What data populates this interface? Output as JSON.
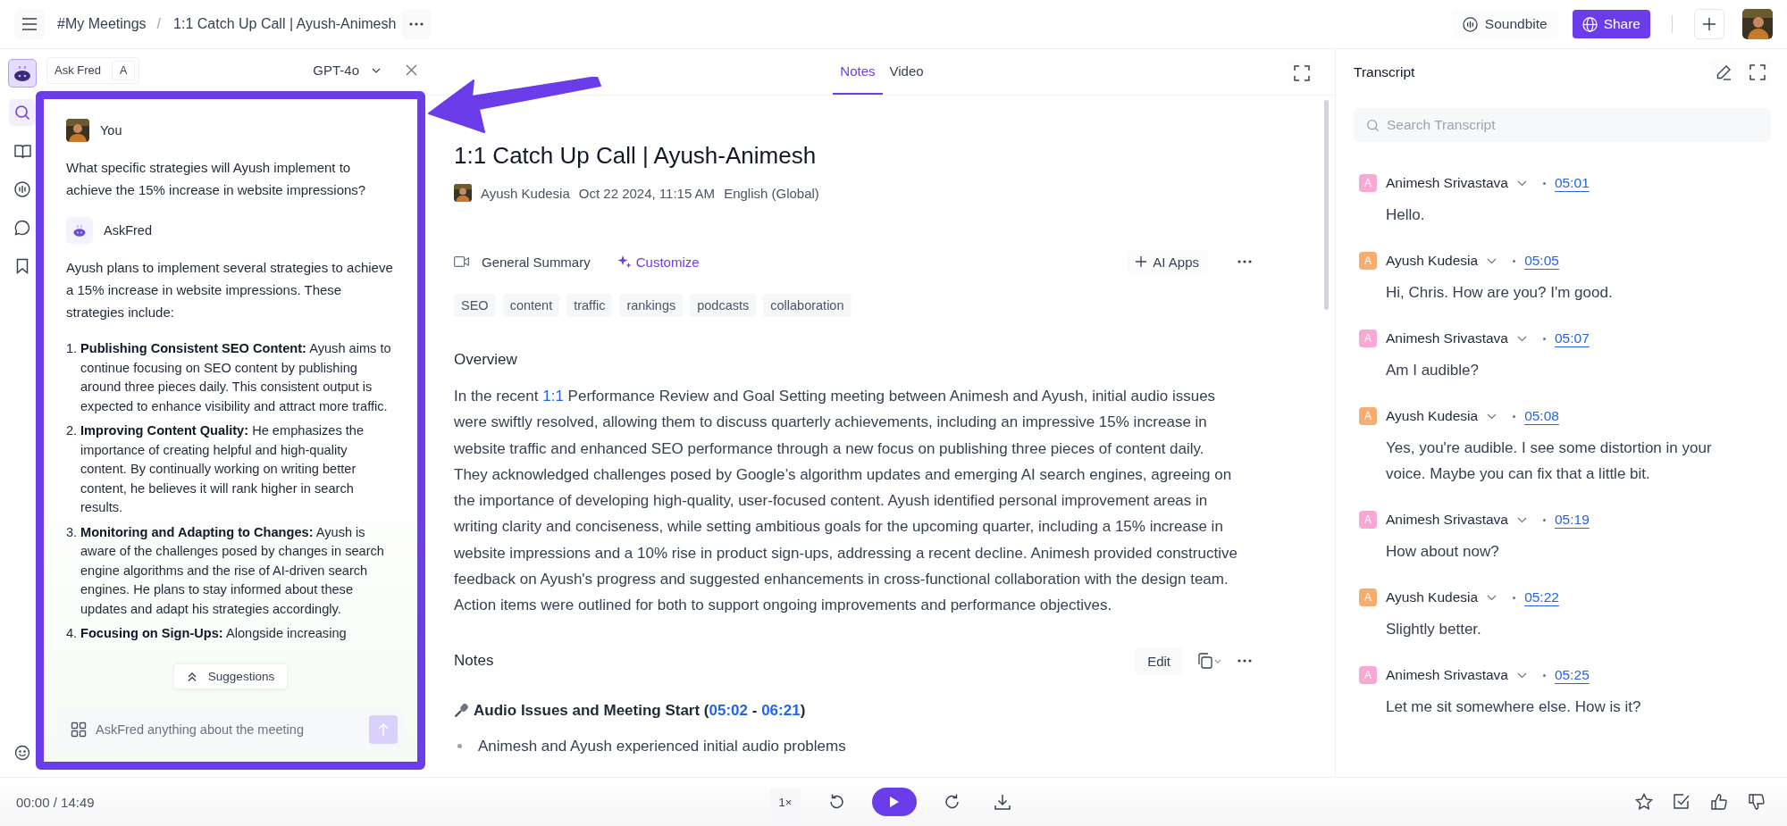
{
  "breadcrumb": {
    "items": [
      "#My Meetings",
      "1:1 Catch Up Call | Ayush-Animesh"
    ],
    "separator": "/"
  },
  "header_actions": {
    "soundbite": "Soundbite",
    "share": "Share"
  },
  "rail": [
    {
      "kind": "search",
      "selected": true
    },
    {
      "kind": "book",
      "selected": false
    },
    {
      "kind": "wave",
      "selected": false
    },
    {
      "kind": "chat",
      "selected": false
    },
    {
      "kind": "bookmark",
      "selected": false
    }
  ],
  "askfred": {
    "chip": "Ask Fred",
    "shortcut": "A",
    "model": "GPT-4o",
    "messages": [
      {
        "kind": "user",
        "author": "You",
        "text": "What specific strategies will Ayush implement to achieve the 15% increase in website impressions?"
      },
      {
        "kind": "bot",
        "author": "AskFred",
        "text": "Ayush plans to implement several strategies to achieve a 15% increase in website impressions. These strategies include:",
        "items": [
          {
            "num": "1.",
            "text": "**Publishing Consistent SEO Content:** Ayush aims to continue focusing on SEO content by publishing around three pieces daily. This consistent output is expected to enhance visibility and attract more traffic."
          },
          {
            "num": "2.",
            "text": "**Improving Content Quality:** He emphasizes the importance of creating helpful and high-quality content. By continually working on writing better content, he believes it will rank higher in search results."
          },
          {
            "num": "3.",
            "text": "**Monitoring and Adapting to Changes:** Ayush is aware of the challenges posed by changes in search engine algorithms and the rise of AI-driven search engines. He plans to stay informed about these updates and adapt his strategies accordingly."
          },
          {
            "num": "4.",
            "text": "**Focusing on Sign-Ups:** Alongside increasing"
          }
        ]
      }
    ],
    "suggestions": "Suggestions",
    "placeholder": "AskFred anything about the meeting"
  },
  "tabs": [
    {
      "label": "Notes",
      "selected": true
    },
    {
      "label": "Video",
      "selected": false
    }
  ],
  "meeting": {
    "title": "1:1 Catch Up Call | Ayush-Animesh",
    "host": "Ayush Kudesia",
    "date": "Oct 22 2024, 11:15 AM",
    "language": "English (Global)"
  },
  "summary_bar": {
    "template": "General Summary",
    "customize": "Customize",
    "ai_apps": "AI Apps"
  },
  "tags": [
    "SEO",
    "content",
    "traffic",
    "rankings",
    "podcasts",
    "collaboration"
  ],
  "overview": {
    "heading": "Overview",
    "segments": [
      {
        "text": "In the recent ",
        "link": false
      },
      {
        "text": "1:1",
        "link": true
      },
      {
        "text": " Performance Review and Goal Setting meeting between Animesh and Ayush, initial audio issues were swiftly resolved, allowing them to discuss quarterly achievements, including an impressive 15% increase in website traffic and enhanced SEO performance through a new focus on publishing three pieces of content daily. They acknowledged challenges posed by Google’s algorithm updates and emerging AI search engines, agreeing on the importance of developing high-quality, user-focused content. Ayush identified personal improvement areas in writing clarity and conciseness, while setting ambitious goals for the upcoming quarter, including a 15% increase in website impressions and a 10% rise in product sign-ups, addressing a recent decline. Animesh provided constructive feedback on Ayush's progress and suggested enhancements in cross-functional collaboration with the design team. Action items were outlined for both to support ongoing improvements and performance objectives.",
        "link": false
      }
    ]
  },
  "notes": {
    "heading": "Notes",
    "edit": "Edit",
    "section": [
      {
        "text": "Audio Issues and Meeting Start (",
        "link": false
      },
      {
        "text": "05:02",
        "link": true
      },
      {
        "text": " - ",
        "link": false
      },
      {
        "text": "06:21",
        "link": true
      },
      {
        "text": ")",
        "link": false
      }
    ],
    "bullets": [
      "Animesh and Ayush experienced initial audio problems"
    ]
  },
  "transcript": {
    "title": "Transcript",
    "placeholder": "Search Transcript",
    "entries": [
      {
        "initial": "A",
        "speaker": "Animesh Srivastava",
        "color": "#f9a8d4",
        "time": "05:01",
        "text": "Hello."
      },
      {
        "initial": "A",
        "speaker": "Ayush Kudesia",
        "color": "#f6ad6f",
        "time": "05:05",
        "text": "Hi, Chris. How are you? I'm good."
      },
      {
        "initial": "A",
        "speaker": "Animesh Srivastava",
        "color": "#f9a8d4",
        "time": "05:07",
        "text": "Am I audible?"
      },
      {
        "initial": "A",
        "speaker": "Ayush Kudesia",
        "color": "#f6ad6f",
        "time": "05:08",
        "text": "Yes, you're audible. I see some distortion in your voice. Maybe you can fix that a little bit."
      },
      {
        "initial": "A",
        "speaker": "Animesh Srivastava",
        "color": "#f9a8d4",
        "time": "05:19",
        "text": "How about now?"
      },
      {
        "initial": "A",
        "speaker": "Ayush Kudesia",
        "color": "#f6ad6f",
        "time": "05:22",
        "text": "Slightly better."
      },
      {
        "initial": "A",
        "speaker": "Animesh Srivastava",
        "color": "#f9a8d4",
        "time": "05:25",
        "text": "Let me sit somewhere else. How is it?"
      }
    ]
  },
  "player": {
    "elapsed": "00:00 / 14:49",
    "speed": "1×"
  }
}
